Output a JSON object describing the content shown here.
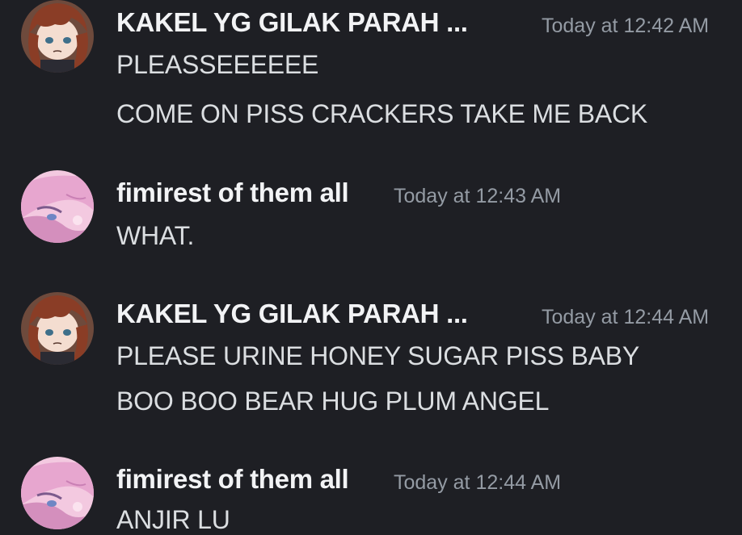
{
  "messages": [
    {
      "author": "KAKEL YG GILAK PARAH ...",
      "timestamp": "Today at 12:42 AM",
      "avatar": "brown-haired-anime-avatar",
      "lines": [
        "PLEASSEEEEEE",
        "COME ON PISS CRACKERS TAKE ME BACK"
      ]
    },
    {
      "author": "fimirest of them all",
      "timestamp": "Today at 12:43 AM",
      "avatar": "pink-haired-anime-avatar",
      "lines": [
        "WHAT."
      ]
    },
    {
      "author": "KAKEL YG GILAK PARAH ...",
      "timestamp": "Today at 12:44 AM",
      "avatar": "brown-haired-anime-avatar",
      "lines": [
        "PLEASE URINE HONEY SUGAR PISS BABY",
        "BOO BOO BEAR HUG PLUM ANGEL"
      ]
    },
    {
      "author": "fimirest of them all",
      "timestamp": "Today at 12:44 AM",
      "avatar": "pink-haired-anime-avatar",
      "lines": [
        "ANJIR LU"
      ]
    }
  ],
  "colors": {
    "background": "#1e1f24",
    "author": "#f2f3f5",
    "timestamp": "#949ba4",
    "text": "#dbdee1"
  }
}
